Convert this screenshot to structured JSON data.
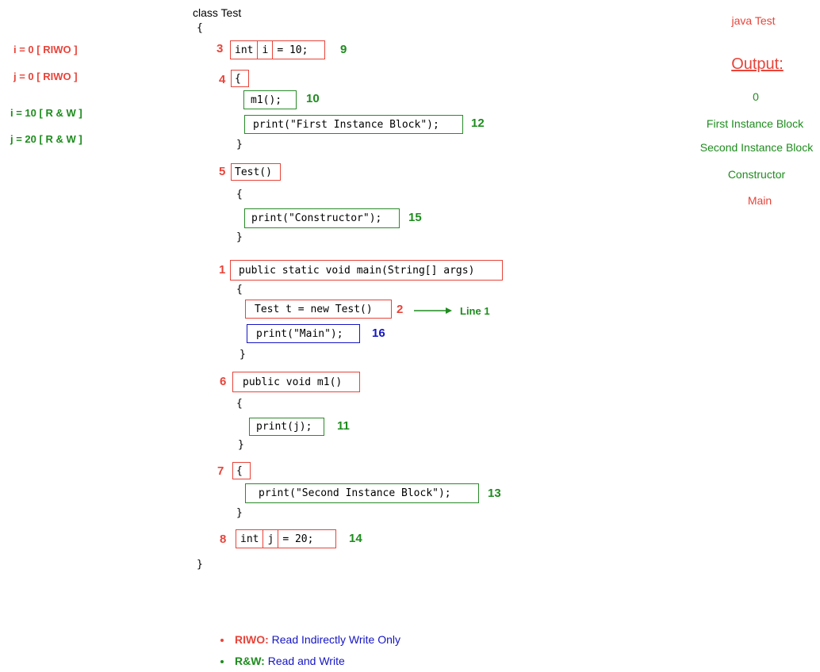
{
  "left_notes": {
    "i_riwo": "i = 0 [ RIWO ]",
    "j_riwo": "j = 0 [ RIWO ]",
    "i_rw": "i = 10 [ R & W ]",
    "j_rw": "j = 20 [ R & W ]"
  },
  "code": {
    "class_decl": "class Test",
    "open_brace": "{",
    "close_brace": "}",
    "int_kw": "int",
    "var_i": "i",
    "assign_10": "= 10;",
    "var_j": "j",
    "assign_20": "= 20;",
    "m1_call": "m1();",
    "print_first": "print(\"First Instance Block\");",
    "constructor_sig": "Test()",
    "print_constructor": "print(\"Constructor\");",
    "main_sig": "public static void main(String[] args)",
    "new_test": "Test t = new Test()",
    "print_main": "print(\"Main\");",
    "m1_sig": "public void m1()",
    "print_j": "print(j);",
    "print_second": "print(\"Second Instance Block\");",
    "arrow_label": "Line 1"
  },
  "steps": {
    "s1": "1",
    "s2": "2",
    "s3": "3",
    "s4": "4",
    "s5": "5",
    "s6": "6",
    "s7": "7",
    "s8": "8",
    "s9": "9",
    "s10": "10",
    "s11": "11",
    "s12": "12",
    "s13": "13",
    "s14": "14",
    "s15": "15",
    "s16": "16"
  },
  "output": {
    "command": "java Test",
    "heading": "Output:",
    "lines": [
      "0",
      "First Instance Block",
      "Second Instance Block",
      "Constructor",
      "Main"
    ]
  },
  "legend": {
    "riwo_term": "RIWO:",
    "riwo_desc": "Read Indirectly Write Only",
    "rw_term": "R&W:",
    "rw_desc": "Read and Write"
  },
  "colors": {
    "red": "#e8443a",
    "green": "#1e8c1e",
    "blue": "#1515c4"
  }
}
